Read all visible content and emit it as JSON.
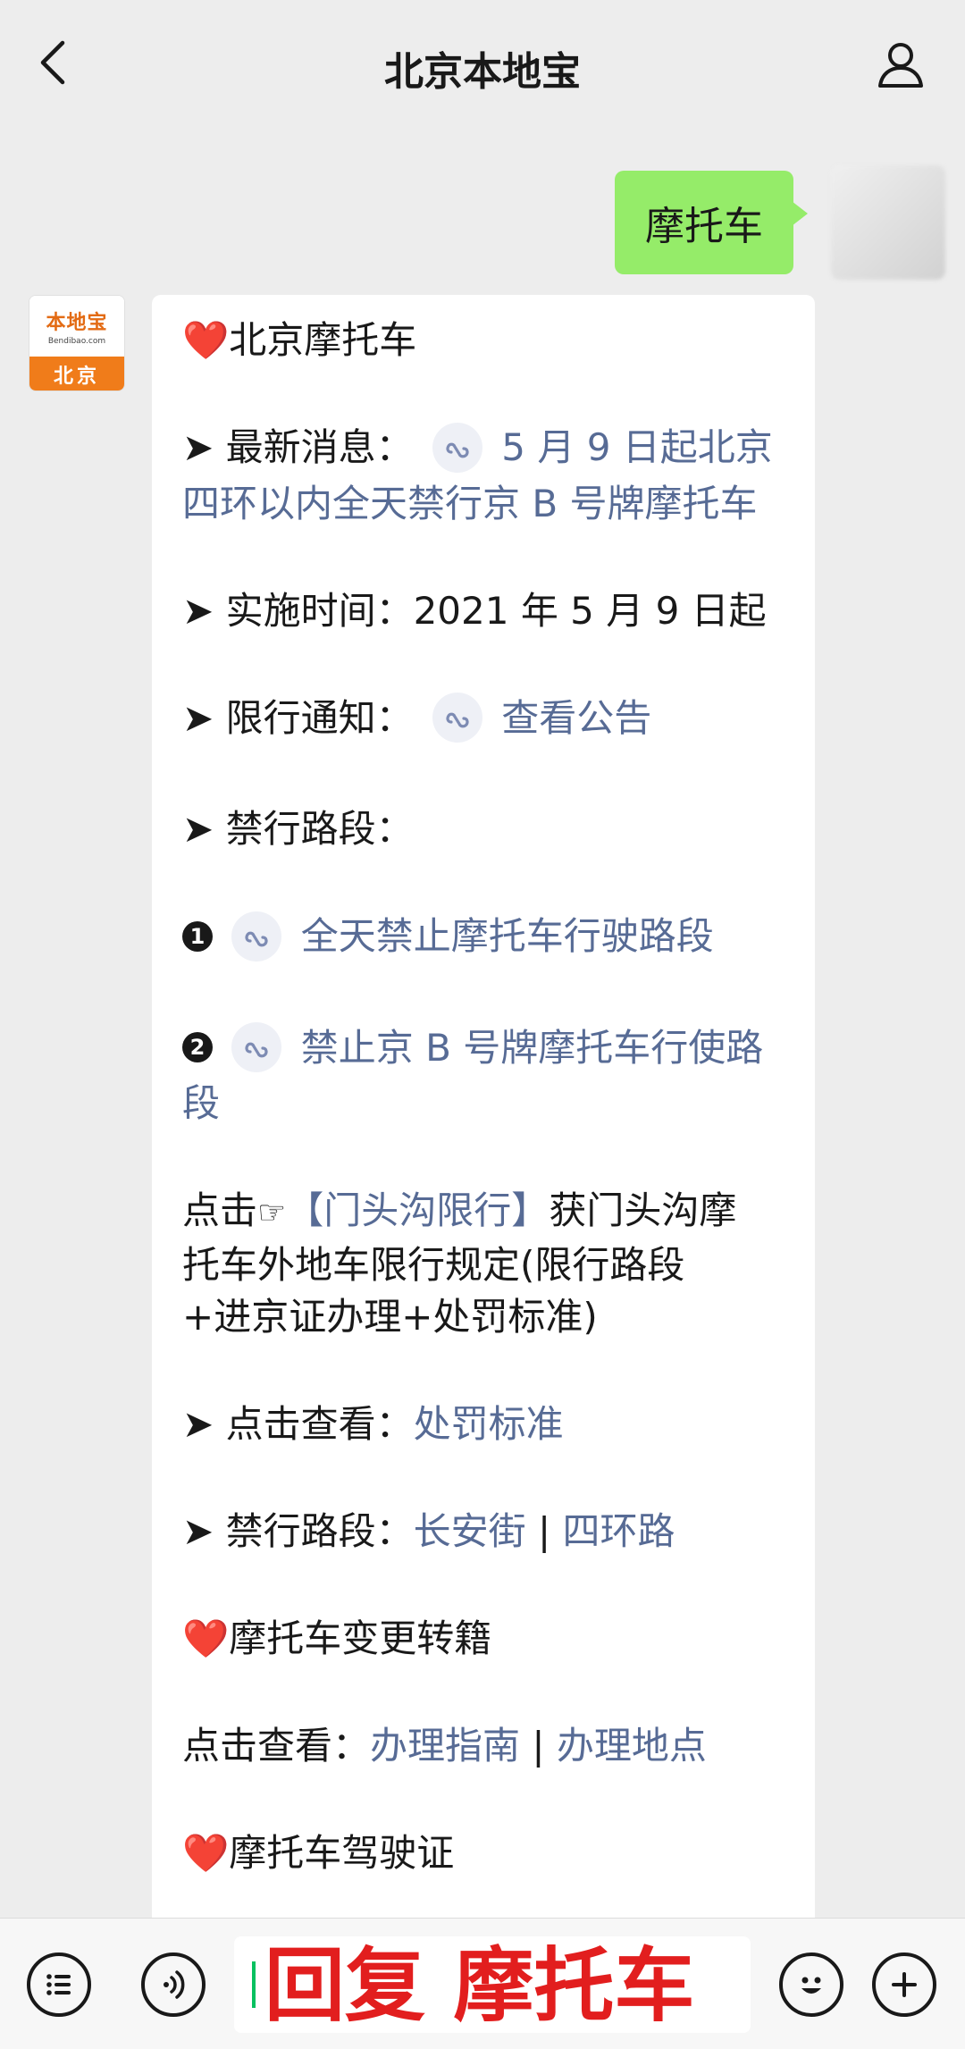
{
  "header": {
    "title": "北京本地宝"
  },
  "sent": {
    "text": "摩托车"
  },
  "bot_avatar": {
    "brand": "本地宝",
    "domain": "Bendibao.com",
    "city": "北京"
  },
  "message": {
    "sec1_heart": "❤️",
    "sec1_title": "北京摩托车",
    "arrow": "➤",
    "latest_label": "最新消息：",
    "latest_link_a": "5 月 9 日起北京",
    "latest_link_b": "四环以内全天禁行京 B 号牌摩托车",
    "impl_label": "实施时间：",
    "impl_value": "2021 年 5 月 9 日起",
    "notice_label": "限行通知：",
    "notice_link": "查看公告",
    "roads_label": "禁行路段：",
    "item1_num": "1",
    "item1_link": "全天禁止摩托车行驶路段",
    "item2_num": "2",
    "item2_link_a": "禁止京 B 号牌摩托车行使路",
    "item2_link_b": "段",
    "click_prefix": "点击",
    "hand": "☞",
    "mentougou_link": "【门头沟限行】",
    "mentougou_a": "获门头沟摩",
    "mentougou_b": "托车外地车限行规定(限行路段",
    "mentougou_c": "+进京证办理+处罚标准)",
    "penalty_label": "点击查看：",
    "penalty_link": "处罚标准",
    "roads2_label": "禁行路段：",
    "roads2_link1": "长安街",
    "sep": " | ",
    "roads2_link2": "四环路",
    "sec2_title": "摩托车变更转籍",
    "transfer_label": "点击查看：",
    "transfer_link1": "办理指南",
    "transfer_link2": "办理地点",
    "sec3_title": "摩托车驾驶证"
  },
  "input": {
    "value": "回复 摩托车"
  },
  "icons": {
    "back": "chevron-left-icon",
    "profile": "person-icon",
    "mini_program": "mini-program-link-icon",
    "menu": "list-menu-icon",
    "voice": "voice-icon",
    "emoji": "emoji-icon",
    "plus": "plus-icon"
  },
  "colors": {
    "background": "#ededed",
    "sent_bubble": "#95ec69",
    "link": "#576b95",
    "reply_text": "#e21e1e",
    "brand_orange": "#f07c1a"
  }
}
